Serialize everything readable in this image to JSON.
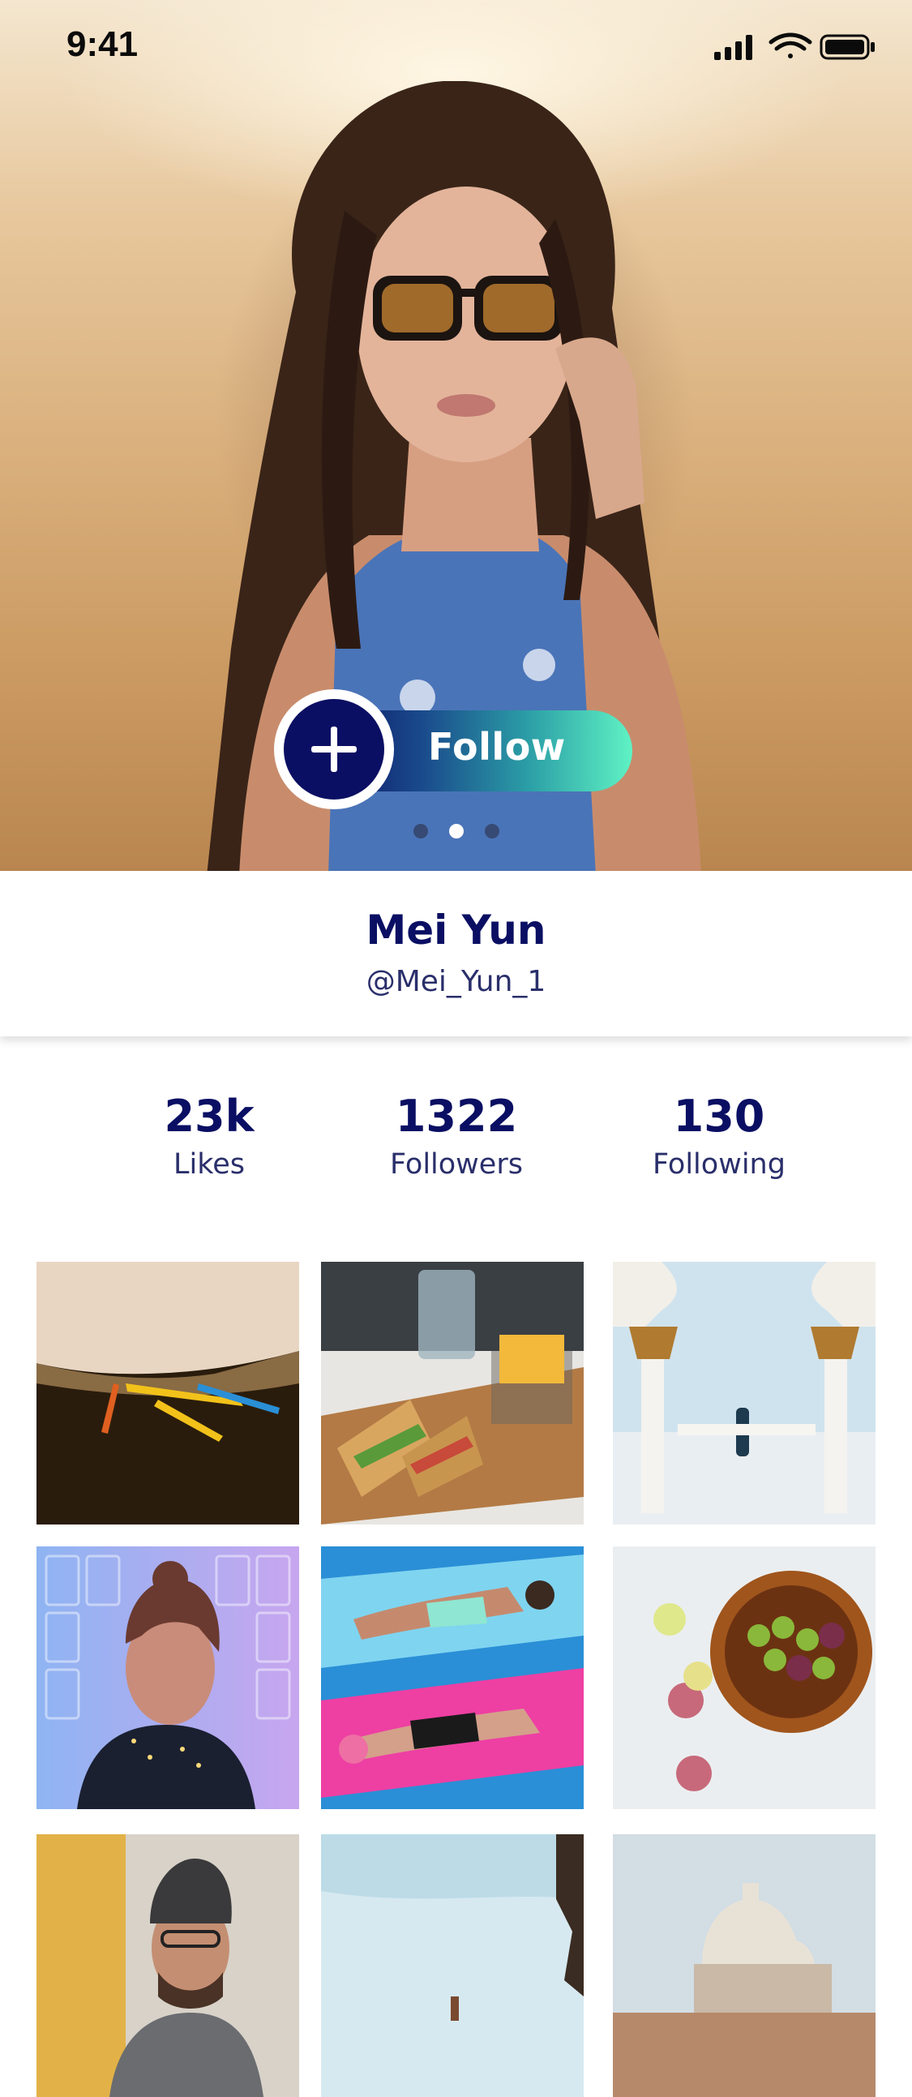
{
  "status_bar": {
    "time": "9:41",
    "icons": [
      "signal-icon",
      "wifi-icon",
      "battery-icon"
    ]
  },
  "hero": {
    "image": "profile-cover-photo",
    "follow_label": "Follow",
    "follow_icon": "plus-icon",
    "carousel": {
      "count": 3,
      "active_index": 1
    }
  },
  "profile": {
    "name": "Mei Yun",
    "handle": "@Mei_Yun_1"
  },
  "stats": [
    {
      "value": "23k",
      "label": "Likes"
    },
    {
      "value": "1322",
      "label": "Followers"
    },
    {
      "value": "130",
      "label": "Following"
    }
  ],
  "gallery": [
    "beach-boats-photo",
    "sandwich-fries-photo",
    "mosque-columns-photo",
    "woman-lights-photo",
    "pool-floats-photo",
    "fruit-bowl-photo",
    "man-beanie-photo",
    "beach-sky-photo",
    "domed-city-photo"
  ],
  "colors": {
    "primary": "#0a0f63",
    "gradient_start": "#0c1a6a",
    "gradient_end": "#5ff2c4"
  }
}
